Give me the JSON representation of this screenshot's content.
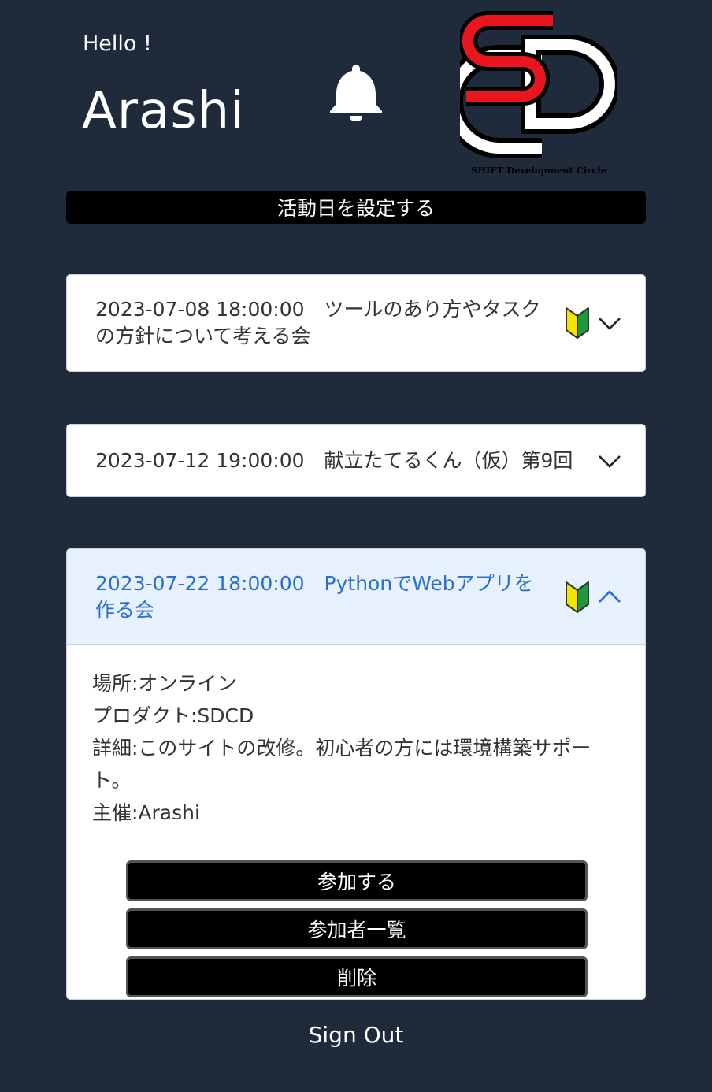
{
  "header": {
    "greeting": "Hello !",
    "username": "Arashi",
    "logo_caption": "SHIFT Development Circle"
  },
  "set_date_button": "活動日を設定する",
  "events": [
    {
      "title": "2023-07-08 18:00:00　ツールのあり方やタスクの方針について考える会",
      "beginner_friendly": true,
      "expanded": false
    },
    {
      "title": "2023-07-12 19:00:00　献立たてるくん（仮）第9回",
      "beginner_friendly": false,
      "expanded": false
    },
    {
      "title": "2023-07-22 18:00:00　PythonでWebアプリを作る会",
      "beginner_friendly": true,
      "expanded": true,
      "details": [
        "場所:オンライン",
        "プロダクト:SDCD",
        "詳細:このサイトの改修。初心者の方には環境構築サポート。",
        "主催:Arashi"
      ],
      "buttons": {
        "join": "参加する",
        "participants": "参加者一覧",
        "delete": "削除"
      }
    }
  ],
  "sign_out": "Sign Out",
  "colors": {
    "background": "#1f2b3a",
    "logo_red": "#e8171f",
    "expanded_header": "#e7f1fd",
    "expanded_title": "#2a6fc9",
    "beginner_yellow": "#f2e500",
    "beginner_green": "#1e9a3c"
  },
  "icons": [
    "bell-icon",
    "beginner-mark-icon",
    "chevron-down-icon",
    "chevron-up-icon"
  ]
}
